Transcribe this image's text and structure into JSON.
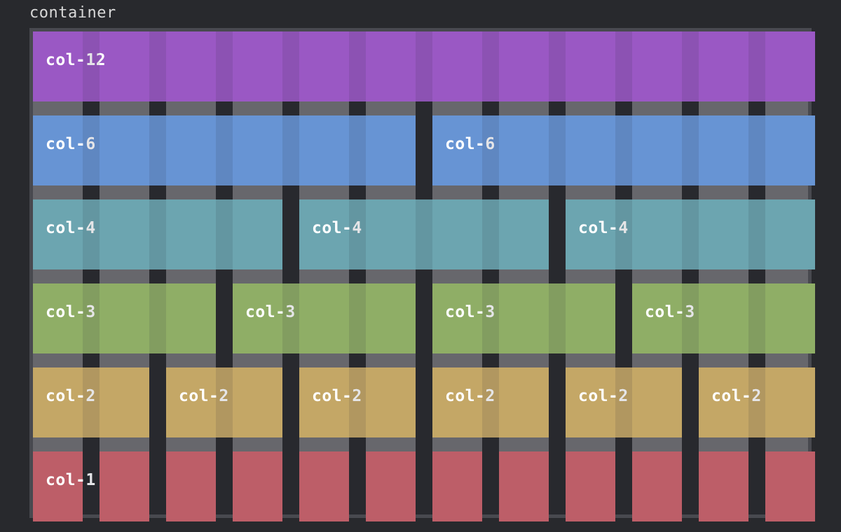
{
  "title": "container",
  "colors": {
    "background": "#28292d",
    "frame": "#48494f",
    "track": "#67676c",
    "col12": "#9a58c4",
    "col6": "#6794d4",
    "col4": "#6ca5b0",
    "col3": "#8fae66",
    "col2": "#c4a766",
    "col1": "#bd5e68"
  },
  "rows": [
    {
      "span": 12,
      "color": "#9a58c4",
      "cells": [
        {
          "label": "col-12"
        }
      ]
    },
    {
      "span": 6,
      "color": "#6794d4",
      "cells": [
        {
          "label": "col-6"
        },
        {
          "label": "col-6"
        }
      ]
    },
    {
      "span": 4,
      "color": "#6ca5b0",
      "cells": [
        {
          "label": "col-4"
        },
        {
          "label": "col-4"
        },
        {
          "label": "col-4"
        }
      ]
    },
    {
      "span": 3,
      "color": "#8fae66",
      "cells": [
        {
          "label": "col-3"
        },
        {
          "label": "col-3"
        },
        {
          "label": "col-3"
        },
        {
          "label": "col-3"
        }
      ]
    },
    {
      "span": 2,
      "color": "#c4a766",
      "cells": [
        {
          "label": "col-2"
        },
        {
          "label": "col-2"
        },
        {
          "label": "col-2"
        },
        {
          "label": "col-2"
        },
        {
          "label": "col-2"
        },
        {
          "label": "col-2"
        }
      ]
    },
    {
      "span": 1,
      "color": "#bd5e68",
      "cells": [
        {
          "label": "col-1 * 12"
        },
        {
          "label": ""
        },
        {
          "label": ""
        },
        {
          "label": ""
        },
        {
          "label": ""
        },
        {
          "label": ""
        },
        {
          "label": ""
        },
        {
          "label": ""
        },
        {
          "label": ""
        },
        {
          "label": ""
        },
        {
          "label": ""
        },
        {
          "label": ""
        }
      ]
    }
  ]
}
